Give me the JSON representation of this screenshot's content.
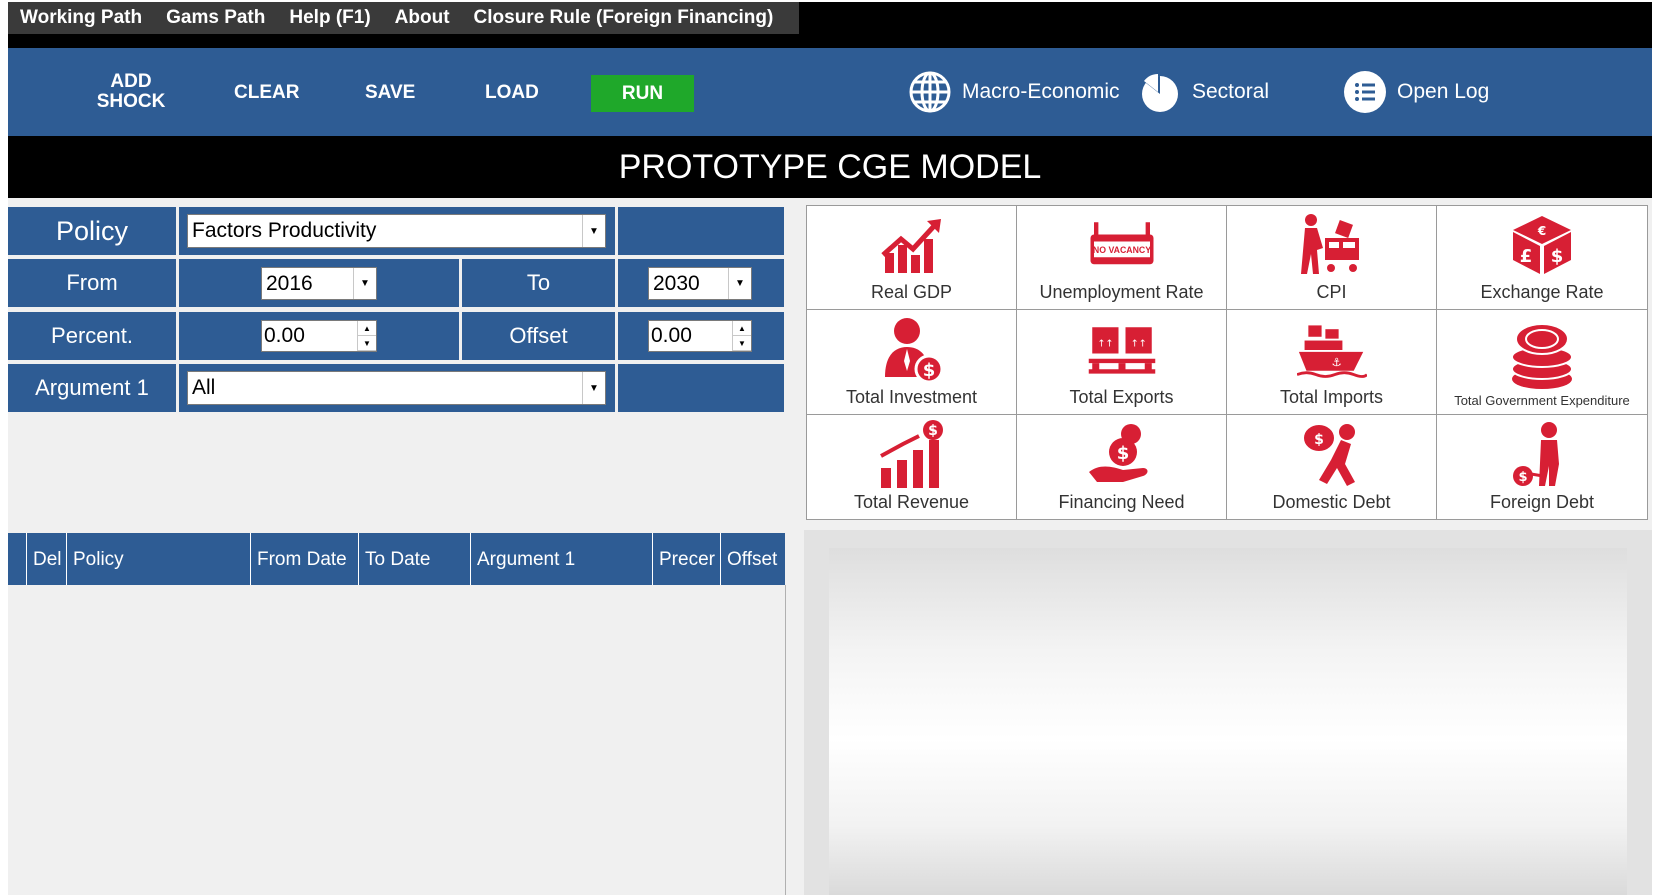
{
  "menu": {
    "items": [
      "Working Path",
      "Gams Path",
      "Help (F1)",
      "About",
      "Closure Rule (Foreign Financing)"
    ]
  },
  "toolbar": {
    "add_shock_line1": "ADD",
    "add_shock_line2": "SHOCK",
    "clear": "CLEAR",
    "save": "SAVE",
    "load": "LOAD",
    "run": "RUN",
    "macro": "Macro-Economic",
    "sectoral": "Sectoral",
    "open_log": "Open Log"
  },
  "title": "PROTOTYPE CGE MODEL",
  "form": {
    "policy_label": "Policy",
    "policy_value": "Factors Productivity",
    "from_label": "From",
    "from_value": "2016",
    "to_label": "To",
    "to_value": "2030",
    "percent_label": "Percent.",
    "percent_value": "0.00",
    "offset_label": "Offset",
    "offset_value": "0.00",
    "argument_label": "Argument 1",
    "argument_value": "All"
  },
  "grid": {
    "columns": [
      "Del",
      "Policy",
      "From Date",
      "To Date",
      "Argument 1",
      "Precer",
      "Offset"
    ]
  },
  "indicators": [
    {
      "label": "Real GDP",
      "icon": "growth-chart-icon"
    },
    {
      "label": "Unemployment Rate",
      "icon": "no-vacancy-sign-icon"
    },
    {
      "label": "CPI",
      "icon": "shopping-cart-icon"
    },
    {
      "label": "Exchange Rate",
      "icon": "currency-cube-icon"
    },
    {
      "label": "Total Investment",
      "icon": "investor-icon"
    },
    {
      "label": "Total Exports",
      "icon": "pallet-boxes-icon"
    },
    {
      "label": "Total Imports",
      "icon": "cargo-ship-icon"
    },
    {
      "label": "Total Government Expenditure",
      "icon": "coin-stack-icon"
    },
    {
      "label": "Total Revenue",
      "icon": "revenue-bars-icon"
    },
    {
      "label": "Financing Need",
      "icon": "hand-coin-icon"
    },
    {
      "label": "Domestic Debt",
      "icon": "debt-burden-icon"
    },
    {
      "label": "Foreign Debt",
      "icon": "ball-and-chain-icon"
    }
  ],
  "colors": {
    "toolbar": "#2e5c94",
    "run": "#1fa82a",
    "icon_red": "#d71f34"
  }
}
